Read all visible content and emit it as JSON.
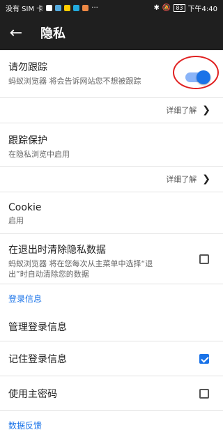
{
  "status": {
    "carrier": "没有 SIM 卡",
    "time": "下午4:40",
    "battery": "83"
  },
  "appbar": {
    "back_icon": "back-arrow-icon",
    "title": "隐私"
  },
  "dnt": {
    "title": "请勿跟踪",
    "subtitle": "蚂蚁浏览器 将会告诉网站您不想被跟踪",
    "enabled": true,
    "learn_more": "详细了解"
  },
  "tracking": {
    "title": "跟踪保护",
    "subtitle": "在隐私浏览中启用",
    "learn_more": "详细了解"
  },
  "cookie": {
    "title": "Cookie",
    "subtitle": "启用"
  },
  "clear_on_exit": {
    "title": "在退出时清除隐私数据",
    "subtitle_line1": "蚂蚁浏览器 将在您每次从主菜单中选择“退",
    "subtitle_line2": "出”时自动清除您的数据",
    "checked": false
  },
  "login_section": {
    "header": "登录信息",
    "manage": "管理登录信息",
    "remember": "记住登录信息",
    "remember_checked": true,
    "master_password": "使用主密码",
    "master_checked": false
  },
  "feedback_section": {
    "header": "数据反馈"
  },
  "colors": {
    "accent": "#1a73e8",
    "bar": "#1f1f1f",
    "highlight_circle": "#e02020"
  }
}
